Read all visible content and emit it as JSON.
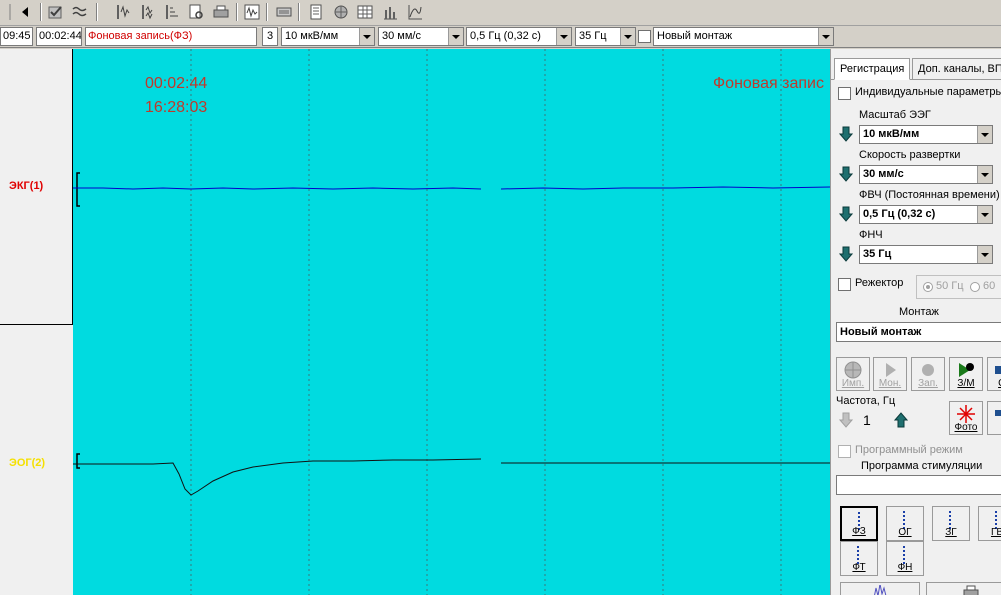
{
  "toolbar": {
    "icons": [
      "back-arrow-icon",
      "settings-check-icon",
      "waves-icon",
      "channel-1-icon",
      "channel-2-icon",
      "channel-3-icon",
      "preview-icon",
      "print-icon",
      "scan-icon",
      "keyboard-icon",
      "document-icon",
      "globe-icon",
      "table-icon",
      "bars-chart-icon",
      "line-chart-icon"
    ]
  },
  "status": {
    "time_clock": "09:45",
    "elapsed": "00:02:44",
    "record_name": "Фоновая запись(ФЗ)",
    "record_color": "#d00000",
    "channel_count": "3",
    "scale": "10 мкВ/мм",
    "speed": "30 мм/с",
    "hpf": "0,5 Гц (0,32 с)",
    "lpf": "35 Гц",
    "montage": "Новый монтаж"
  },
  "channels": [
    {
      "label": "ЭКГ(1)",
      "color": "#e00000"
    },
    {
      "label": "ЭОГ(2)",
      "color": "#f5e000"
    }
  ],
  "plot": {
    "background": "#00dbe0",
    "elapsed": "00:02:44",
    "clock": "16:28:03",
    "record_title": "Фоновая запис",
    "trace_colors": {
      "ekg": "#0000cc",
      "eog": "#111111"
    }
  },
  "panel": {
    "tabs": [
      "Регистрация",
      "Доп. каналы, ВП"
    ],
    "individual_params": "Индивидуальные параметры",
    "scale_label": "Масштаб ЭЭГ",
    "scale_value": "10 мкВ/мм",
    "speed_label": "Скорость развертки",
    "speed_value": "30 мм/с",
    "hpf_label": "ФВЧ (Постоянная времени)",
    "hpf_value": "0,5 Гц (0,32 с)",
    "lpf_label": "ФНЧ",
    "lpf_value": "35 Гц",
    "notch_label": "Режектор",
    "notch_50": "50 Гц",
    "notch_60": "60",
    "montage_label": "Монтаж",
    "montage_value": "Новый монтаж",
    "buttons": [
      "Имп.",
      "Мон.",
      "Зап.",
      "З/М",
      "Ст"
    ],
    "freq_label": "Частота, Гц",
    "freq_value": "1",
    "photo": "Фото",
    "program_mode": "Программный режим",
    "stim_program": "Программа стимуляции",
    "prog_buttons": [
      "ФЗ",
      "ОГ",
      "ЗГ",
      "ГВ",
      "ФТ",
      "ФН"
    ]
  }
}
